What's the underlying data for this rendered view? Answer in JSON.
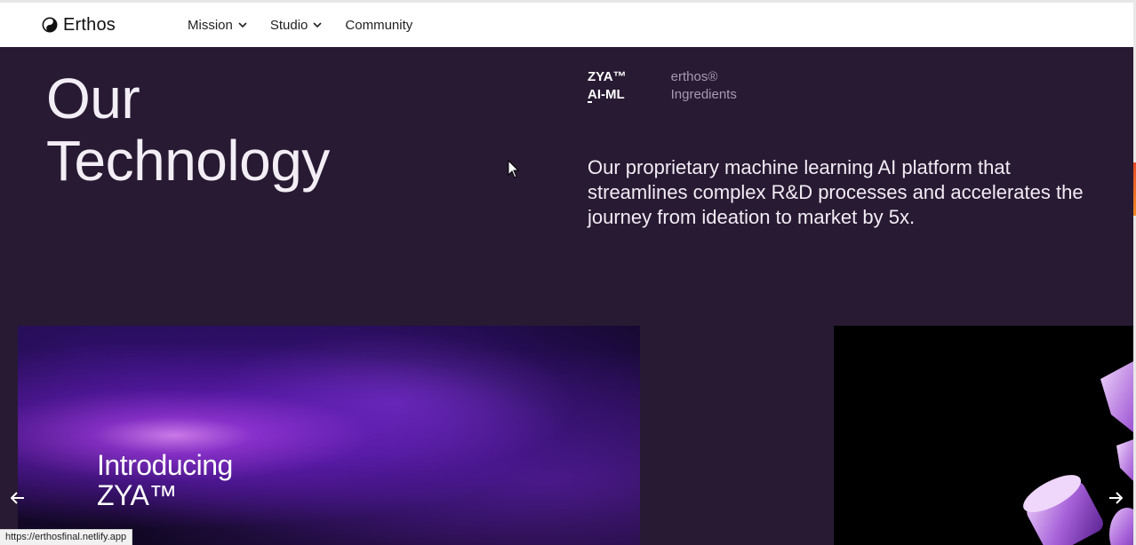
{
  "header": {
    "brand": "Erthos",
    "nav": [
      {
        "label": "Mission",
        "has_dropdown": true
      },
      {
        "label": "Studio",
        "has_dropdown": true
      },
      {
        "label": "Community",
        "has_dropdown": false
      }
    ]
  },
  "hero": {
    "title_line1": "Our",
    "title_line2": "Technology",
    "tabs": [
      {
        "line1": "ZYA™",
        "line2": "AI-ML",
        "active": true
      },
      {
        "line1": "erthos®",
        "line2": "Ingredients",
        "active": false
      }
    ],
    "description": "Our proprietary machine learning AI platform that streamlines complex R&D processes and accelerates the journey from ideation to market by 5x."
  },
  "carousel": {
    "card1_line1": "Introducing",
    "card1_line2": "ZYA™",
    "prev_icon": "arrow-left-icon",
    "next_icon": "arrow-right-icon"
  },
  "status_bar": {
    "url": "https://erthosfinal.netlify.app"
  },
  "colors": {
    "background": "#281a33",
    "header": "#ffffff",
    "accent_purple": "#8a3be0"
  }
}
